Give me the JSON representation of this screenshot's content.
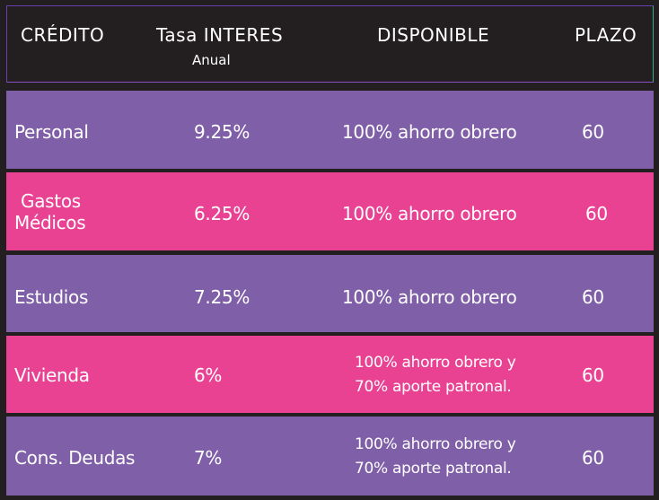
{
  "header": {
    "col_credito": "CRÉDITO",
    "col_tasa": "Tasa INTERES",
    "col_tasa_sub": "Anual",
    "col_disponible": "DISPONIBLE",
    "col_plazo": "PLAZO"
  },
  "rows": [
    {
      "credito": "Personal",
      "tasa": "9.25%",
      "disponible": "100% ahorro obrero",
      "plazo": "60",
      "color": "#7f5fa8"
    },
    {
      "credito_line1": "Gastos",
      "credito_line2": "Médicos",
      "tasa": "6.25%",
      "disponible": "100% ahorro obrero",
      "plazo": "60",
      "color": "#e94293"
    },
    {
      "credito": "Estudios",
      "tasa": "7.25%",
      "disponible": "100% ahorro obrero",
      "plazo": "60",
      "color": "#7f5fa8"
    },
    {
      "credito": "Vivienda",
      "tasa": "6%",
      "disponible_line1": "100% ahorro obrero y",
      "disponible_line2": "70% aporte patronal.",
      "plazo": "60",
      "color": "#e94293"
    },
    {
      "credito": "Cons. Deudas",
      "tasa": "7%",
      "disponible_line1": "100% ahorro obrero y",
      "disponible_line2": "70% aporte patronal.",
      "plazo": "60",
      "color": "#7f5fa8"
    }
  ]
}
